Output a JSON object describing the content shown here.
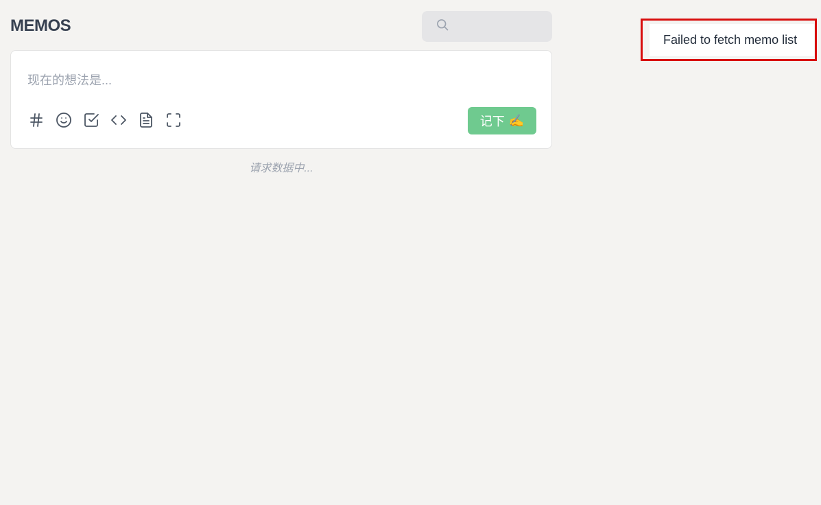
{
  "app": {
    "title": "MEMOS"
  },
  "search": {
    "placeholder": "",
    "value": "",
    "icon": "search-icon"
  },
  "editor": {
    "placeholder": "现在的想法是...",
    "toolbar": [
      {
        "icon": "hashtag-icon"
      },
      {
        "icon": "emoji-icon"
      },
      {
        "icon": "checkbox-icon"
      },
      {
        "icon": "code-icon"
      },
      {
        "icon": "file-text-icon"
      },
      {
        "icon": "fullscreen-icon"
      }
    ],
    "save_label": "记下",
    "save_emoji": "✍️",
    "save_color": "#6fca8f"
  },
  "status": {
    "loading_text": "请求数据中..."
  },
  "toast": {
    "message": "Failed to fetch memo list",
    "highlight_color": "#d80d0d"
  }
}
